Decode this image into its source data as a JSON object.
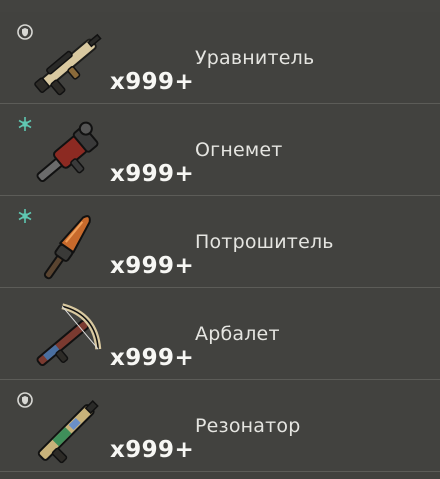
{
  "items": [
    {
      "name": "Уравнитель",
      "quantity": "x999+",
      "badge": "shield-icon",
      "weapon": "rifle-icon"
    },
    {
      "name": "Огнемет",
      "quantity": "x999+",
      "badge": "frost-icon",
      "weapon": "flamethrower-icon"
    },
    {
      "name": "Потрошитель",
      "quantity": "x999+",
      "badge": "frost-icon",
      "weapon": "chainsaw-blade-icon"
    },
    {
      "name": "Арбалет",
      "quantity": "x999+",
      "badge": "",
      "weapon": "crossbow-icon"
    },
    {
      "name": "Резонатор",
      "quantity": "x999+",
      "badge": "shield-icon",
      "weapon": "resonator-gun-icon"
    }
  ],
  "colors": {
    "row_bg": "#42423f",
    "divider": "#5c5c58",
    "name_text": "#e5e5e1",
    "qty_text": "#f7f7f4",
    "frost_badge": "#5fc7b2",
    "shield_badge": "#d8d8d4"
  }
}
